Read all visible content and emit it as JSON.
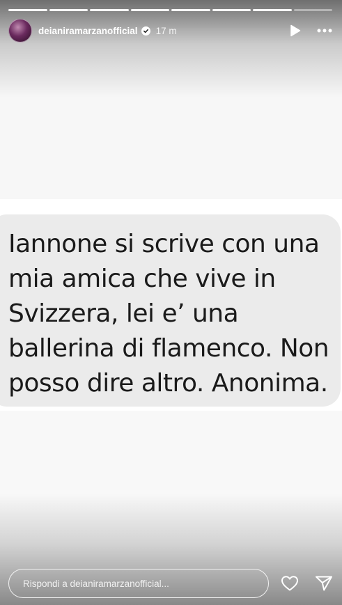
{
  "story": {
    "username": "deianiramarzanofficial",
    "time_ago": "17 m",
    "verified": true,
    "progress": {
      "total_segments": 8,
      "viewed_segments": 7
    },
    "message_text": "Iannone si scrive con una\nmia amica che vive in\nSvizzera, lei e’ una\nballerina di flamenco. Non\nposso dire altro. Anonima."
  },
  "reply": {
    "placeholder": "Rispondi a deianiramarzanofficial..."
  },
  "icons": {
    "verified": "verified-badge-icon",
    "play": "play-icon",
    "more": "more-options-icon",
    "heart": "heart-icon",
    "send": "send-icon"
  },
  "colors": {
    "bubble": "#ebebeb",
    "text": "#1a1a1a",
    "overlay_text": "#ffffff"
  }
}
